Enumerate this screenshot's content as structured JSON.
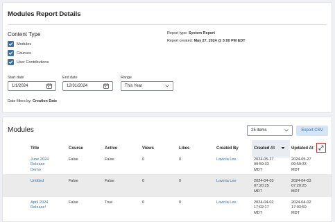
{
  "details": {
    "title": "Modules Report Details",
    "content_type_heading": "Content Type",
    "checkboxes": [
      {
        "label": "Modules",
        "checked": true
      },
      {
        "label": "Courses",
        "checked": true
      },
      {
        "label": "User Contributions",
        "checked": true
      }
    ],
    "report_type_prefix": "Report type:",
    "report_type_value": "System Report",
    "report_created_prefix": "Report created:",
    "report_created_value": "May 27, 2024 @ 3:00 PM EDT",
    "start_date_label": "Start date",
    "start_date_value": "1/1/2024",
    "end_date_label": "End date",
    "end_date_value": "12/31/2024",
    "range_label": "Range",
    "range_value": "This Year",
    "filters_prefix": "Date filters by:",
    "filters_value": "Creation Date"
  },
  "modules": {
    "title": "Modules",
    "items_select": "25 items",
    "export_label": "Export CSV",
    "columns": [
      "Title",
      "Course",
      "Active",
      "Views",
      "Likes",
      "Created By",
      "Created At",
      "Updated At"
    ],
    "rows": [
      {
        "title": "June 2024\nRelease\nDemo",
        "course": "False",
        "active": "False",
        "views": "0",
        "likes": "0",
        "created_by": "Lavinia Lee",
        "created_at": "2024-05-27\n09:59:33\nMDT",
        "updated_at": "2024-05-27\n09:59:33\nMDT"
      },
      {
        "title": "Untitled",
        "course": "False",
        "active": "False",
        "views": "0",
        "likes": "0",
        "created_by": "Lavinia Lee",
        "created_at": "2024-04-03\n07:20:25\nMDT",
        "updated_at": "2024-04-03\n07:20:25\nMDT"
      },
      {
        "title": "April 2024\nRelease!",
        "course": "False",
        "active": "True",
        "views": "0",
        "likes": "0",
        "created_by": "Lavinia Lee",
        "created_at": "2024-04-02\n17:02:17\nMDT",
        "updated_at": "2024-04-02\n17:03:59\nMDT"
      }
    ]
  },
  "colors": {
    "accent": "#3a6ea5",
    "highlight_border": "#d9302c"
  },
  "icons": {
    "checkbox": "check-icon",
    "calendar": "calendar-icon",
    "dropdown": "chevron-down-icon",
    "sort": "caret-down-icon",
    "expand": "expand-icon"
  }
}
